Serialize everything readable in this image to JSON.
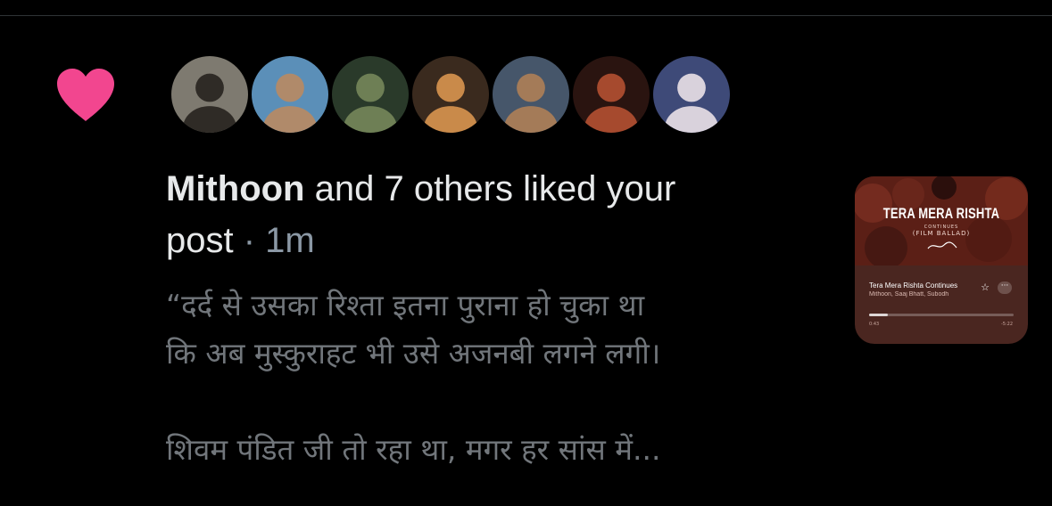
{
  "notification": {
    "type": "like",
    "heart_color": "#f2468f",
    "avatars": [
      {
        "name": "avatar-1",
        "bg": "#7e7a70",
        "fg": "#2f2b26"
      },
      {
        "name": "avatar-2",
        "bg": "#5b8fb8",
        "fg": "#b08a6a"
      },
      {
        "name": "avatar-3",
        "bg": "#2a3a2a",
        "fg": "#6e7f55"
      },
      {
        "name": "avatar-4",
        "bg": "#3a2a1e",
        "fg": "#c98a4a"
      },
      {
        "name": "avatar-5",
        "bg": "#46566a",
        "fg": "#a47b58"
      },
      {
        "name": "avatar-6",
        "bg": "#2a1410",
        "fg": "#a64a2e"
      },
      {
        "name": "avatar-7",
        "bg": "#3e4a78",
        "fg": "#d9d2dc"
      }
    ],
    "actor": "Mithoon",
    "action_line1": " and 7 others liked your",
    "action_line2": "post",
    "separator": " · ",
    "time": "1m",
    "preview_lines": [
      "“दर्द से उसका रिश्ता इतना पुराना हो चुका था",
      "कि अब मुस्कुराहट भी उसे अजनबी लगने लगी।",
      "",
      "शिवम पंडित जी तो रहा था, मगर हर सांस में..."
    ]
  },
  "media": {
    "art_title": "TERA MERA RISHTA",
    "art_subtitle": "CONTINUES",
    "art_tag": "(FILM BALLAD)",
    "song_title": "Tera Mera Rishta Continues",
    "artists": "Mithoon, Saaj Bhatt, Subodh",
    "time_elapsed": "0:43",
    "time_remaining": "-5:22",
    "progress": 0.13,
    "accent": "#4a2620"
  }
}
